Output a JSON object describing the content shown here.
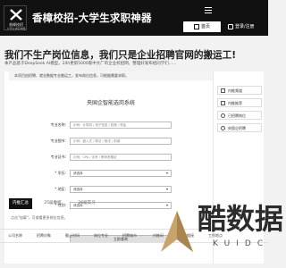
{
  "header": {
    "logo_name": "香樟校招",
    "logo_sub": "大学生求职神器",
    "title": "香樟校招-大学生求职神器",
    "nav_home": "首页",
    "nav_login": "登录/注册"
  },
  "hero": {
    "headline": "我们不生产岗位信息，我们只是企业招聘官网的搬运工!",
    "subline": "本产品基于DeepSeek AI模型，24h更新5000家中大厂的企业校招网，整理好发布给同学们......"
  },
  "form": {
    "notice": "本项目由招聘、就业数据专业搬运工，发布岗位信息，可根据需要求职。",
    "title": "央国企智能选岗系统",
    "rows": [
      {
        "label": "专业名称:",
        "placeholder": "示例：计算机 / 电子信息 / 机械 / 财会"
      },
      {
        "label": "专业细节:",
        "placeholder": "示例：嵌入式 / 算法 / 测试 / 前端"
      },
      {
        "label": "专业证书:",
        "placeholder": "示例：CPA / 法考 / 教师资格证"
      },
      {
        "label": "* 学历:",
        "value": "请选择"
      },
      {
        "label": "* 地区:",
        "value": "请选择"
      },
      {
        "label": "* 性别:",
        "value": "请选择"
      }
    ],
    "submit": "立即查询"
  },
  "side": {
    "items": [
      {
        "label": "内推频道"
      },
      {
        "label": "内推推荐"
      },
      {
        "label": "已招聘岗位"
      },
      {
        "label": "央国企招聘"
      }
    ]
  },
  "tabs": [
    {
      "label": "内推汇总"
    },
    {
      "label": "25届春招"
    },
    {
      "label": "26届实习"
    }
  ],
  "tips": "点击\"加载\"，可查看更多岗位信息。",
  "table_headers": [
    "公司名称",
    "招聘对象",
    "截止时间",
    "岗位专业",
    "招聘城市",
    "内推码",
    "投递链接",
    "工作地点"
  ],
  "watermark": {
    "main": "酷数据",
    "sub": "KUIDC"
  },
  "colors": {
    "header_bg": "#111111",
    "accent": "#111111",
    "page_bg": "#f2f2f2"
  }
}
